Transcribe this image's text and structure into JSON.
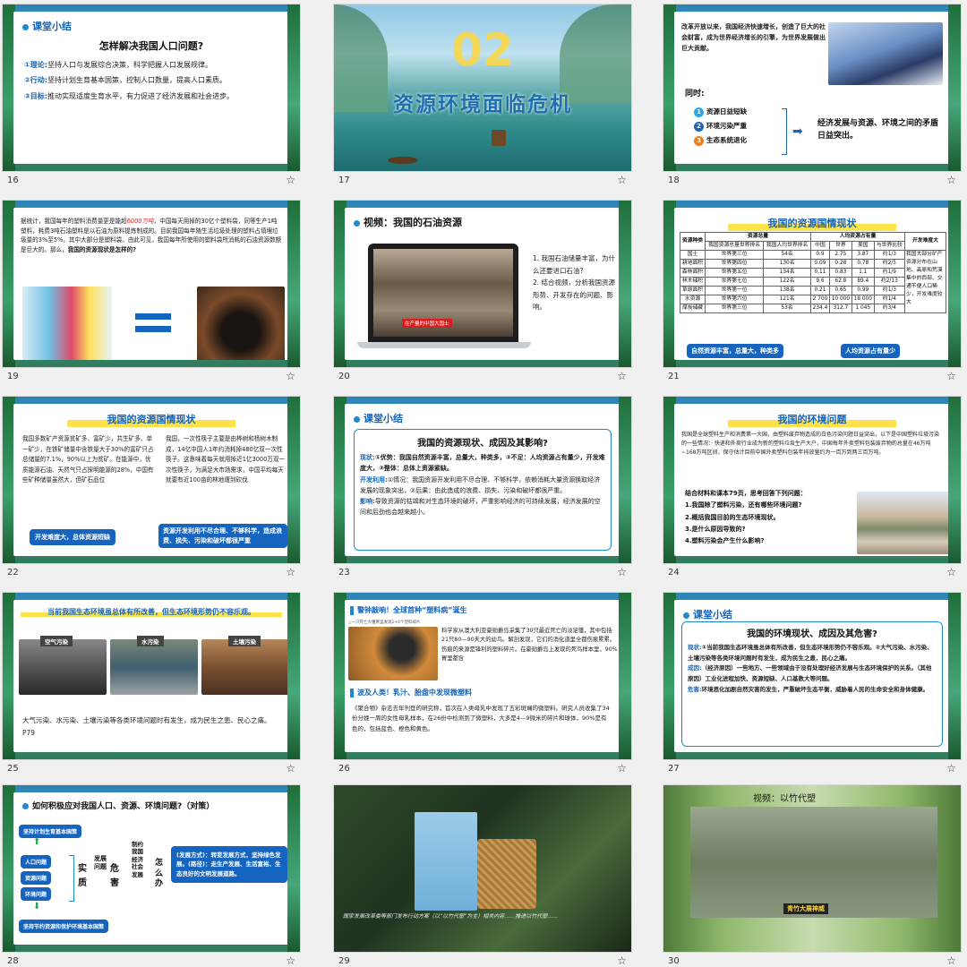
{
  "slides": [
    {
      "num": "16",
      "header": "课堂小结",
      "title": "怎样解决我国人口问题?",
      "lines": [
        {
          "tag": "①理论:",
          "text": "坚持人口与发展综合决策，科学把握人口发展规律。"
        },
        {
          "tag": "②行动:",
          "text": "坚持计划生育基本国策，控制人口数量，提高人口素质。"
        },
        {
          "tag": "③目标:",
          "text": "推动实现适度生育水平，有力促进了经济发展和社会进步。"
        }
      ]
    },
    {
      "num": "17",
      "section_no": "02",
      "section_title": "资源环境面临危机"
    },
    {
      "num": "18",
      "intro": "改革开放以来，我国经济快速增长，创造了巨大的社会财富，成为世界经济增长的引擎，为世界发展做出巨大贡献。",
      "meanwhile": "同时:",
      "items": [
        "资源日益短缺",
        "环境污染严重",
        "生态系统退化"
      ],
      "conclusion": "经济发展与资源、环境之间的矛盾日益突出。"
    },
    {
      "num": "19",
      "text_a": "据统计，我国每年的塑料消费量更是能超",
      "highlight": "6000万吨",
      "text_b": "，中国每天用掉的30亿个塑料袋，同等生产1吨塑料，耗费3吨石油塑料是以石油为原料提炼制成的。目前我国每年随生活垃圾处理的塑料占填埋垃圾量的3%至5%，其中大部分是塑料袋。由此可见，我国每年所使用的塑料袋所消耗的石油资源数额是巨大的。那么，",
      "question": "我国的资源现状是怎样的?"
    },
    {
      "num": "20",
      "header": "视频：我国的石油资源",
      "caption": "在产量的中国大国士",
      "questions": [
        "1. 我国石油储量丰富，为什么还要进口石油?",
        "2. 结合视频，分析我国资源形势、开发存在的问题、影响。"
      ]
    },
    {
      "num": "21",
      "title": "我国的资源国情现状",
      "table": {
        "head1": [
          "资源种类",
          "资源总量",
          "人均资源占有量",
          "开发难度大"
        ],
        "head2": [
          "我国资源总量世界排名",
          "我国人均世界排名",
          "中国",
          "世界",
          "美国",
          "与世界比较"
        ],
        "rows": [
          [
            "国土",
            "世界第三位",
            "54名",
            "0.9",
            "2.75",
            "3.87",
            "约1/3"
          ],
          [
            "耕地面积",
            "世界第四位",
            "130名",
            "0.09",
            "0.28",
            "0.78",
            "约2/5"
          ],
          [
            "森林面积",
            "世界第五位",
            "134名",
            "0.11",
            "0.83",
            "1.1",
            "约1/9"
          ],
          [
            "林木储积",
            "世界第七位",
            "122名",
            "9.6",
            "62.8",
            "89.4",
            "约2/13"
          ],
          [
            "草原面积",
            "世界第一位",
            "138名",
            "0.21",
            "0.65",
            "0.99",
            "约1/3"
          ],
          [
            "水资源",
            "世界第六位",
            "121名",
            "2 700",
            "10 000",
            "18 000",
            "约1/4"
          ],
          [
            "煤炭储藏",
            "世界第三位",
            "53名",
            "234.4",
            "312.7",
            "1 045",
            "约3/4"
          ]
        ],
        "side_note": "我国大部分矿产资源分布在山地、高原和荒漠集中的西部、交通不便人口稀少，开发难度较大"
      },
      "tag_left": "自然资源丰富，总量大，种类多",
      "tag_right": "人均资源占有量少"
    },
    {
      "num": "22",
      "title": "我国的资源国情现状",
      "col_left": "我国多数矿产资源贫矿多、富矿少，共生矿多、单一矿少，在铁矿储量中含铁量大于30%的富矿只占总储量的7.1%，90%以上为贫矿。在能源中，优质能源石油、天然气只占探明能源的28%，中国有些矿种储量虽然大，但矿石品位",
      "col_right": "我国，一次性筷子主要是由桦树和杨树木制成，14亿中国人1年约消耗掉480亿双一次性筷子。这意味着每天就用掉近1亿3000万双一次性筷子，为满足大市场需求，中国平均每天就要有近100亩的林地遭到砍伐",
      "tag_left": "开发难度大，总体资源短缺",
      "tag_right": "资源开发利用不尽合理、不够科学，造成浪费、损失、污染和破坏都很严重"
    },
    {
      "num": "23",
      "header": "课堂小结",
      "title": "我国的资源现状、成因及其影响?",
      "lines": [
        {
          "tag": "现状:",
          "text": "①优势：我国自然资源丰富，总量大，种类多，②不足：人均资源占有量少，开发难度大，③整体：总体上资源紧缺。"
        },
        {
          "tag": "开发利用:",
          "text": "①情况：我国资源开发利用不尽合理、不够科学，依赖消耗大量资源换取经济发展的现象突出，②后果：由此造成的浪费、损失、污染和破坏都很严重。"
        },
        {
          "tag": "影响:",
          "text": "导致资源的枯竭和对生态环境的破坏，严重影响经济的可持续发展，经济发展的空间和后劲也会越来越小。"
        }
      ]
    },
    {
      "num": "24",
      "title": "我国的环境问题",
      "para": "我国是全球塑料生产和消费第一大国，由塑料废弃物造成的白色污染问题日益突出，以下是中国塑料垃圾污染的一些情况：· 快递和外卖行业成为新的塑料垃圾生产大户，中国每年外卖塑料包装废弃物的总量在46万吨~168万吨区间，保守估计目前中国外卖塑料包装年排放量约为一百万到两三百万吨。",
      "prompt": "结合材料和课本79页，思考回答下列问题：",
      "questions": [
        "1.我国除了塑料污染，还有哪些环境问题?",
        "2.概括我国目前的生态环境现状。",
        "3.是什么原因导致的?",
        "4.塑料污染会产生什么影响?"
      ]
    },
    {
      "num": "25",
      "title": "当前我国生态环境虽总体有所改善，但生态环境形势仍不容乐观。",
      "labels": [
        "空气污染",
        "水污染",
        "土壤污染"
      ],
      "caption": "大气污染、水污染、土壤污染等各类环境问题时有发生，成为民生之患、民心之痛。P79"
    },
    {
      "num": "26",
      "banner1": "警钟敲响！全球首种“塑料病”诞生",
      "subcap": "△一只死亡大鹱胃里发现1+4个塑料碎片",
      "story1": "科学家从澳大利亚豪勋爵岛采集了30只最近死亡的淡足鹱，其中包括21只80—90天大的幼鸟。解剖发现，它们的消化道里全都伤痕累累。伤痕的来源是锋利的塑料碎片。在豪勋爵岛上发现的死鸟样本里，90%胃里都含",
      "banner2": "波及人类！乳汁、胎盘中发现微塑料",
      "story2": "《聚合物》杂志去年刊登的研究称，首次在人类母乳中发现了五彩斑斓的微塑料。研究人员收集了34份分娩一周的女性母乳样本，在26份中检测到了微塑料，大多是4—9微米的碎片和球体，90%是有色的，包括蓝色、橙色和黄色。"
    },
    {
      "num": "27",
      "header": "课堂小结",
      "title": "我国的环境现状、成因及其危害?",
      "lines": [
        {
          "tag": "现状:",
          "text": "①当前我国生态环境虽总体有所改善，但生态环境形势仍不容乐观。②大气污染、水污染、土壤污染等各类环境问题时有发生，成为民生之患，民心之痛。"
        },
        {
          "tag": "成因:",
          "text": "（经济原因）一些地方、一些领域由于没有处理好经济发展与生态环境保护的关系。（其他原因）工业化进程加快、资源短缺、人口基数大等问题。"
        },
        {
          "tag": "危害:",
          "text": "环境恶化加剧自然灾害的发生，严重破坏生态平衡，威胁着人民的生命安全和身体健康。"
        }
      ]
    },
    {
      "num": "28",
      "header": "如何积极应对我国人口、资源、环境问题?（对策）",
      "top_box": "坚持计划生育基本国策",
      "bottom_box": "坚持节约资源和保护环境基本国策",
      "problems": [
        "人口问题",
        "资源问题",
        "环境问题"
      ],
      "essence": "实质",
      "dev": "发展问题",
      "harm": "危害",
      "effect": "制约我国经济社会发展",
      "how": "怎么办",
      "solution": "(发展方式)：转变发展方式，坚持绿色发展。(路径)：走生产发展、生活富裕、生态良好的文明发展道路。"
    },
    {
      "num": "29",
      "caption": "国家发展改革委等部门发布行动方案（以“以竹代塑”为主）相关内容……推进以竹代塑……"
    },
    {
      "num": "30",
      "title": "视频：以竹代塑",
      "caption": "青竹大展神威"
    }
  ],
  "colors": {
    "accent": "#1463b6",
    "button": "#1565c0",
    "highlight": "#ffe24a",
    "warn": "#d81e1e"
  }
}
